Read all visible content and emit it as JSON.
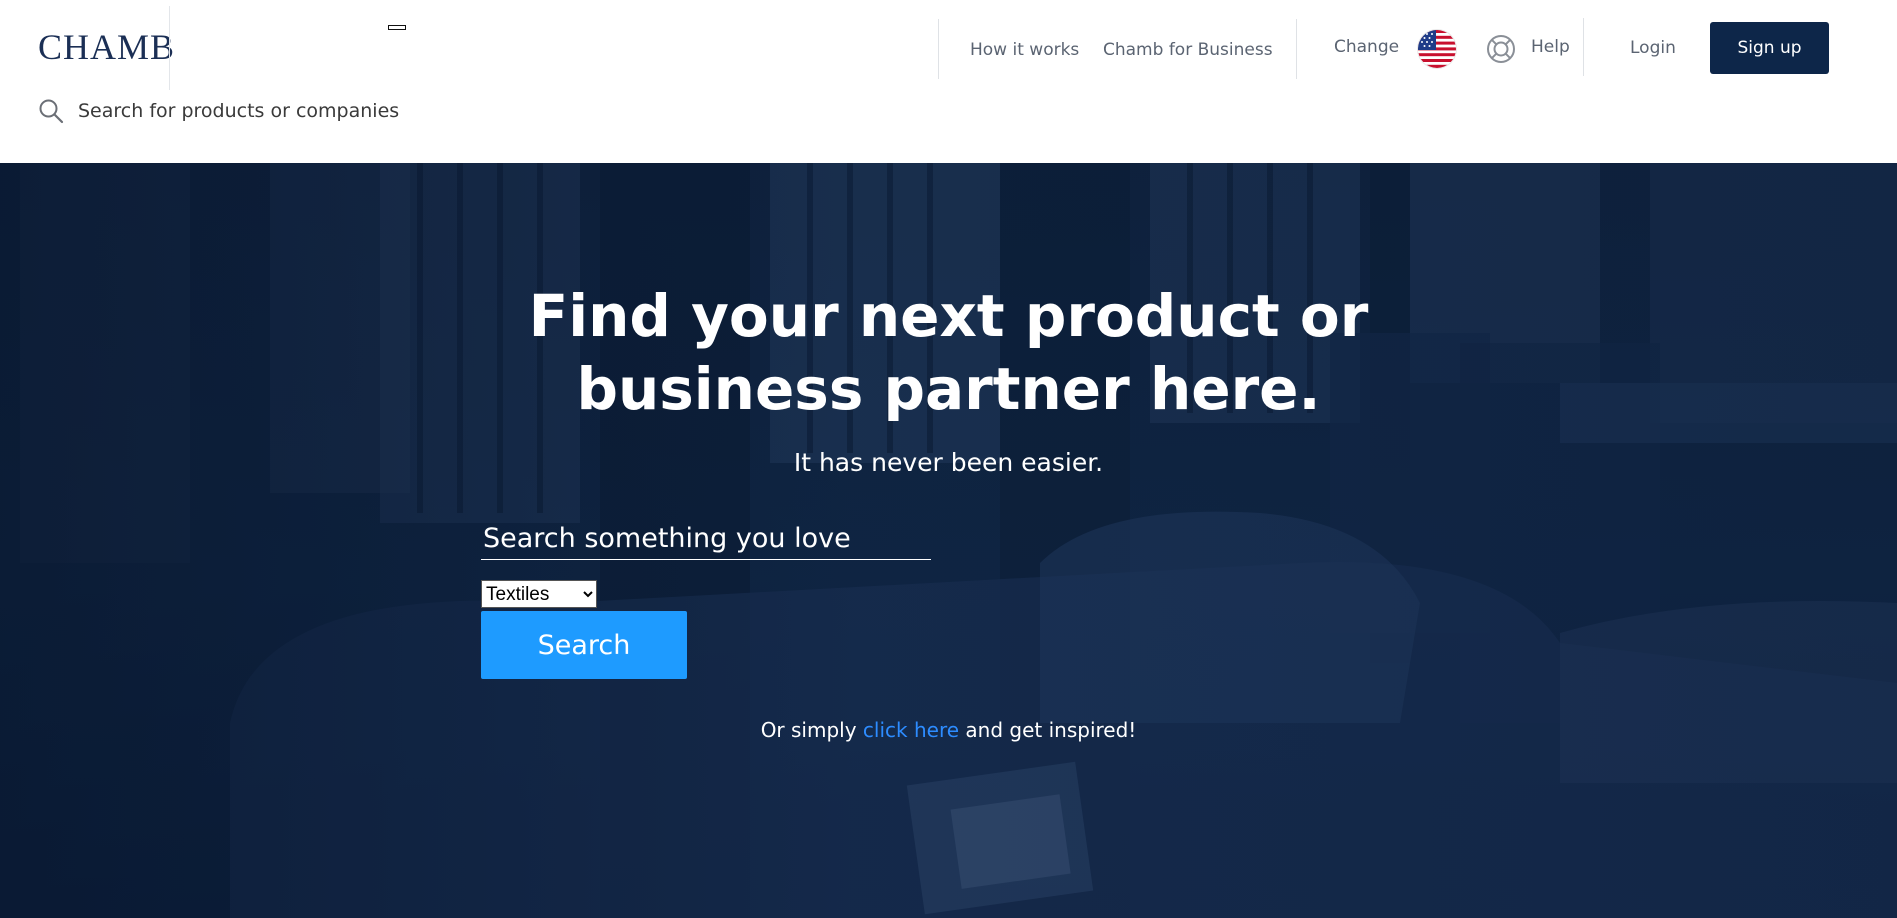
{
  "header": {
    "logo": "CHAMB",
    "search_placeholder": "Search for products or companies",
    "nav": {
      "how_it_works": "How it works",
      "chamb_for_business": "Chamb for Business",
      "change": "Change",
      "help": "Help",
      "login": "Login",
      "signup": "Sign up"
    },
    "flag_icon": "us-flag-icon"
  },
  "hero": {
    "title_line1": "Find your next product or",
    "title_line2": "business partner here.",
    "subtitle": "It has never been easier.",
    "search_placeholder": "Search something you love",
    "category_selected": "Textiles",
    "search_button": "Search",
    "inspire_prefix": "Or simply",
    "inspire_link": "click here",
    "inspire_suffix": "and get inspired!"
  },
  "colors": {
    "brand_navy": "#0d2649",
    "accent_blue": "#1e9bff",
    "link_blue": "#2d8cff"
  }
}
